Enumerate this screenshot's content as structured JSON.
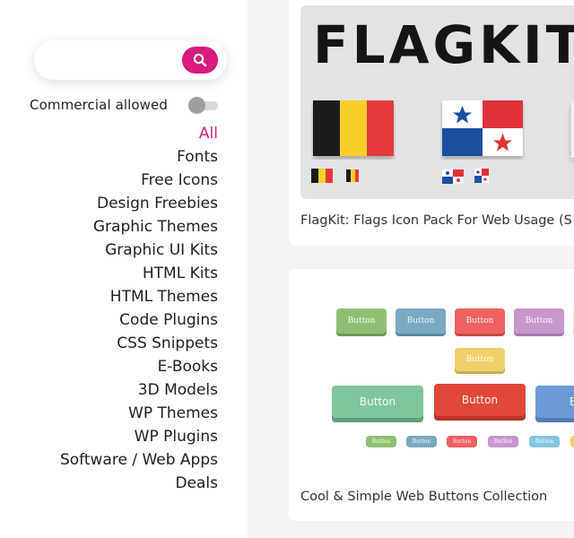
{
  "search": {
    "placeholder": ""
  },
  "filter": {
    "commercial_label": "Commercial allowed",
    "commercial_enabled": false
  },
  "categories": [
    {
      "label": "All",
      "active": true
    },
    {
      "label": "Fonts"
    },
    {
      "label": "Free Icons"
    },
    {
      "label": "Design Freebies"
    },
    {
      "label": "Graphic Themes"
    },
    {
      "label": "Graphic UI Kits"
    },
    {
      "label": "HTML Kits"
    },
    {
      "label": "HTML Themes"
    },
    {
      "label": "Code Plugins"
    },
    {
      "label": "CSS Snippets"
    },
    {
      "label": "E-Books"
    },
    {
      "label": "3D Models"
    },
    {
      "label": "WP Themes"
    },
    {
      "label": "WP Plugins"
    },
    {
      "label": "Software / Web Apps"
    },
    {
      "label": "Deals"
    }
  ],
  "cards": [
    {
      "title": "FlagKit: Flags Icon Pack For Web Usage (S",
      "thumb_text": "FLAGKIT"
    },
    {
      "title": "Cool & Simple Web Buttons Collection",
      "button_label": "Button"
    }
  ],
  "colors": {
    "accent": "#d81b7c"
  }
}
